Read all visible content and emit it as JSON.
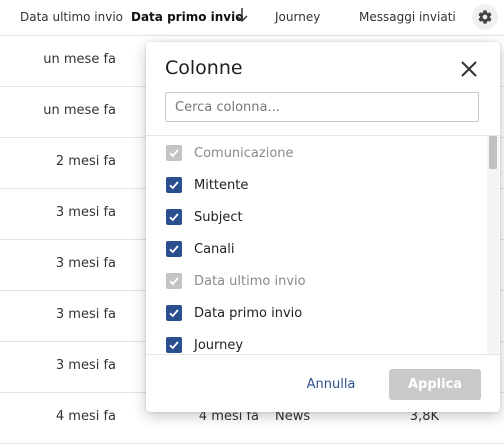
{
  "table": {
    "headers": {
      "last_send": "Data ultimo invio",
      "first_send": "Data primo invio",
      "journey": "Journey",
      "sent": "Messaggi inviati"
    },
    "rows": [
      {
        "last_send": "un mese fa"
      },
      {
        "last_send": "un mese fa"
      },
      {
        "last_send": "2 mesi fa"
      },
      {
        "last_send": "3 mesi fa"
      },
      {
        "last_send": "3 mesi fa"
      },
      {
        "last_send": "3 mesi fa"
      },
      {
        "last_send": "3 mesi fa"
      },
      {
        "last_send": "4 mesi fa",
        "first_send": "4 mesi fa",
        "journey": "News",
        "sent": "3,8K"
      }
    ]
  },
  "modal": {
    "title": "Colonne",
    "search_placeholder": "Cerca colonna...",
    "options": [
      {
        "label": "Comunicazione",
        "checked": true,
        "disabled": true
      },
      {
        "label": "Mittente",
        "checked": true,
        "disabled": false
      },
      {
        "label": "Subject",
        "checked": true,
        "disabled": false
      },
      {
        "label": "Canali",
        "checked": true,
        "disabled": false
      },
      {
        "label": "Data ultimo invio",
        "checked": true,
        "disabled": true
      },
      {
        "label": "Data primo invio",
        "checked": true,
        "disabled": false
      },
      {
        "label": "Journey",
        "checked": true,
        "disabled": false
      }
    ],
    "cancel_label": "Annulla",
    "apply_label": "Applica"
  },
  "colors": {
    "accent": "#2a4f8f",
    "disabled_check": "#c4c4c4",
    "apply_disabled_bg": "#c9c9c9"
  },
  "icons": {
    "sort": "arrow-down-icon",
    "settings": "gear-icon",
    "close": "close-icon",
    "check": "checkmark-icon"
  }
}
